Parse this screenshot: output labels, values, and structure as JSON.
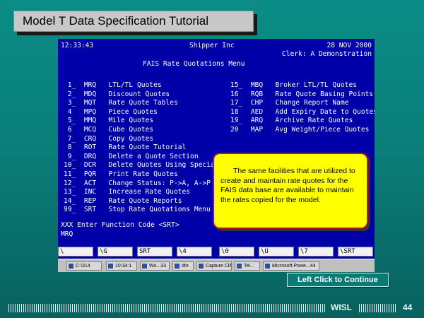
{
  "slide": {
    "title": "Model T Data Specification Tutorial",
    "continue_label": "Left Click to Continue",
    "footer_org": "WISL",
    "page_number": "44"
  },
  "terminal": {
    "time": "12:33:43",
    "company": "Shipper Inc",
    "date": "28 NOV 2000",
    "clerk": "Clerk: A Demonstration",
    "menu_title": "FAIS Rate Quotations Menu",
    "left_items": [
      " 1_  MRQ   LTL/TL Quotes",
      " 2_  MDQ   Discount Quotes",
      " 3_  MQT   Rate Quote Tables",
      " 4   MPQ   Piece Quotes",
      " 5_  MMQ   Mile Quotes",
      " 6   MCQ   Cube Quotes",
      " 7_  CRQ   Copy Quotes",
      " 8   ROT   Rate Quote Tutorial",
      " 9_  DRQ   Delete a Quote Section",
      "10_  DCR   Delete Quotes Using Special",
      "11_  PQR   Print Rate Quotes",
      "12_  ACT   Change Status: P->A, A->P",
      "13_  INC   Increase Rate Quotes",
      "14_  REP   Rate Quote Reports",
      "99_  SRT   Stop Rate Quotations Menu"
    ],
    "right_items": [
      "15_  MBQ   Broker LTL/TL Quotes",
      "16   RQB   Rate Quote Basing Points",
      "17_  CHP   Change Report Name",
      "18   AED   Add Expiry Date to Quotes",
      "19_  ARQ   Archive Rate Quotes",
      "20   MAP   Avg Weight/Piece Quotes"
    ],
    "prompt": "XXX Enter Function Code <SRT>",
    "command": "MRQ",
    "function_keys": [
      "\\",
      "\\G",
      "SRT",
      "\\4",
      "\\0",
      "\\U",
      "\\7",
      "\\SRT"
    ],
    "taskbar_items": [
      "C:\\314",
      "10:34:1",
      "Wo...33",
      "dte",
      "Capture Cliff",
      "Tel...",
      "Microsoft Powe...44"
    ]
  },
  "callout": {
    "text": "The same facilities that are utilized to create and maintain rate quotes for the FAIS data base are available to maintain the rates copied for the model."
  },
  "colors": {
    "background": "#0a7f7a",
    "terminal_bg": "#0000a8",
    "callout_bg": "#ffff00",
    "callout_border": "#9c1c3a"
  }
}
